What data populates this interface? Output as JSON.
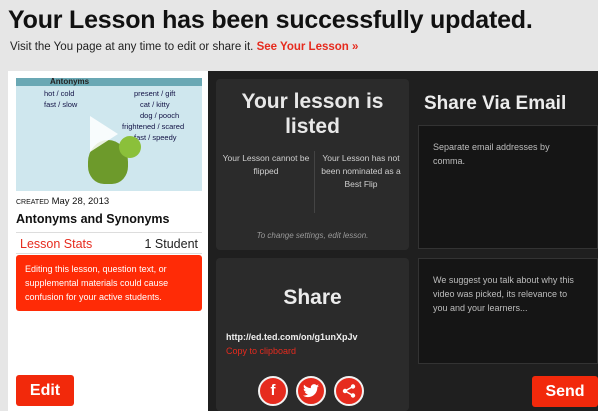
{
  "header": {
    "title": "Your Lesson has been successfully updated.",
    "subtitle": "Visit the You page at any time to edit or share it.",
    "link": "See Your Lesson »"
  },
  "lesson": {
    "thumbnail": {
      "heading": "Antonyms",
      "left_words": [
        "hot / cold",
        "fast / slow"
      ],
      "right_words": [
        "present / gift",
        "cat / kitty",
        "dog / pooch",
        "frightened / scared",
        "fast / speedy"
      ],
      "icon": "play-icon"
    },
    "created_label": "CREATED",
    "created_date": "May 28, 2013",
    "title": "Antonyms and Synonyms",
    "stats_label": "Lesson Stats",
    "students": "1 Student",
    "warning": "Editing this lesson, question text, or supplemental materials could cause confusion for your active students.",
    "edit_label": "Edit"
  },
  "listed": {
    "heading": "Your lesson is listed",
    "flip_status": "Your Lesson cannot be flipped",
    "nomination_status": "Your Lesson has not been nominated as a Best Flip",
    "note": "To change settings, edit lesson."
  },
  "share": {
    "heading": "Share",
    "url": "http://ed.ted.com/on/g1unXpJv",
    "copy_label": "Copy to clipboard",
    "social": [
      {
        "name": "facebook-icon",
        "glyph": "f"
      },
      {
        "name": "twitter-icon",
        "glyph": "🐦"
      },
      {
        "name": "share-icon",
        "glyph": "⋖"
      }
    ]
  },
  "email": {
    "heading": "Share Via Email",
    "addresses_placeholder": "Separate email addresses by comma.",
    "message_placeholder": "We suggest you talk about why this video was picked, its relevance to you and your learners...",
    "send_label": "Send"
  },
  "colors": {
    "accent": "#e62b1e",
    "button": "#f2290b",
    "dark_panel": "#1f1f1f",
    "card": "#2b2b2b"
  }
}
